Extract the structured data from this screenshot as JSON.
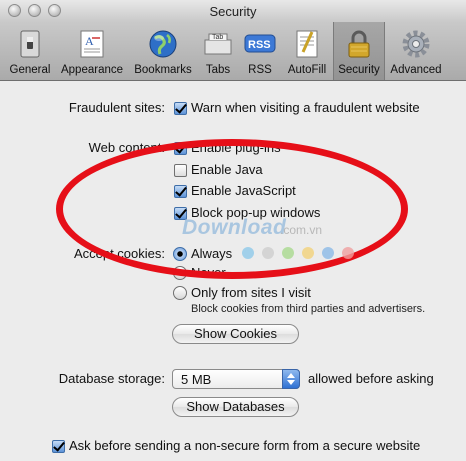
{
  "window": {
    "title": "Security"
  },
  "toolbar": {
    "items": [
      {
        "label": "General",
        "icon": "general-switch-icon"
      },
      {
        "label": "Appearance",
        "icon": "appearance-font-icon"
      },
      {
        "label": "Bookmarks",
        "icon": "globe-icon"
      },
      {
        "label": "Tabs",
        "icon": "tabs-icon",
        "icon_text": "Tab"
      },
      {
        "label": "RSS",
        "icon": "rss-icon",
        "icon_text": "RSS"
      },
      {
        "label": "AutoFill",
        "icon": "autofill-icon"
      },
      {
        "label": "Security",
        "icon": "lock-icon",
        "selected": true
      },
      {
        "label": "Advanced",
        "icon": "gear-icon"
      }
    ]
  },
  "fraudulent": {
    "label": "Fraudulent sites:",
    "checkbox": "Warn when visiting a fraudulent website",
    "checked": true
  },
  "web_content": {
    "label": "Web content:",
    "options": [
      {
        "label": "Enable plug-ins",
        "checked": true
      },
      {
        "label": "Enable Java",
        "checked": false
      },
      {
        "label": "Enable JavaScript",
        "checked": true
      },
      {
        "label": "Block pop-up windows",
        "checked": true
      }
    ]
  },
  "cookies": {
    "label": "Accept cookies:",
    "options": [
      {
        "label": "Always",
        "selected": true
      },
      {
        "label": "Never",
        "selected": false
      },
      {
        "label": "Only from sites I visit",
        "selected": false
      }
    ],
    "note": "Block cookies from third parties and advertisers.",
    "show_button": "Show Cookies"
  },
  "database": {
    "label": "Database storage:",
    "value": "5 MB",
    "suffix": "allowed before asking",
    "show_button": "Show Databases"
  },
  "nonsecure_form": {
    "label": "Ask before sending a non-secure form from a secure website",
    "checked": true
  },
  "watermark": {
    "text": "Download",
    "suffix": ".com.vn"
  },
  "colors": {
    "highlight_ellipse": "#e60f18",
    "accent_blue": "#2f71d3"
  }
}
